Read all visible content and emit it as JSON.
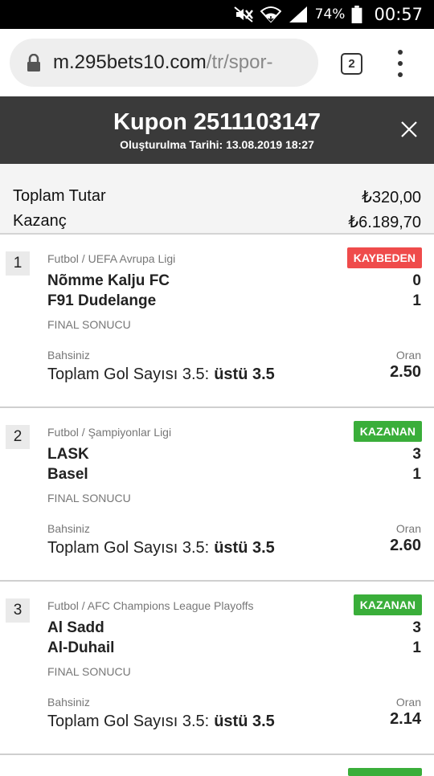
{
  "status_bar": {
    "battery": "74%",
    "time": "00:57"
  },
  "browser": {
    "url_domain": "m.295bets10.com",
    "url_path": "/tr/spor-",
    "tab_count": "2"
  },
  "coupon": {
    "title": "Kupon 2511103147",
    "created": "Oluşturulma Tarihi: 13.08.2019 18:27"
  },
  "summary": {
    "total_label": "Toplam Tutar",
    "total_value": "₺320,00",
    "win_label": "Kazanç",
    "win_value": "₺6.189,70"
  },
  "colors": {
    "lost": "#ef4b4b",
    "won": "#3aae3a",
    "header_bg": "#3a3a3a"
  },
  "bets": [
    {
      "num": "1",
      "league": "Futbol / UEFA Avrupa Ligi",
      "status": "KAYBEDEN",
      "status_color": "#ef4b4b",
      "home": "Nõmme Kalju FC",
      "away": "F91 Dudelange",
      "home_score": "0",
      "away_score": "1",
      "final_label": "FINAL SONUCU",
      "bet_label": "Bahsiniz",
      "odds_label": "Oran",
      "market": "Toplam Gol Sayısı 3.5:",
      "pick": "üstü 3.5",
      "odds": "2.50"
    },
    {
      "num": "2",
      "league": "Futbol / Şampiyonlar Ligi",
      "status": "KAZANAN",
      "status_color": "#3aae3a",
      "home": "LASK",
      "away": "Basel",
      "home_score": "3",
      "away_score": "1",
      "final_label": "FINAL SONUCU",
      "bet_label": "Bahsiniz",
      "odds_label": "Oran",
      "market": "Toplam Gol Sayısı 3.5:",
      "pick": "üstü 3.5",
      "odds": "2.60"
    },
    {
      "num": "3",
      "league": "Futbol / AFC Champions League Playoffs",
      "status": "KAZANAN",
      "status_color": "#3aae3a",
      "home": "Al Sadd",
      "away": "Al-Duhail",
      "home_score": "3",
      "away_score": "1",
      "final_label": "FINAL SONUCU",
      "bet_label": "Bahsiniz",
      "odds_label": "Oran",
      "market": "Toplam Gol Sayısı 3.5:",
      "pick": "üstü 3.5",
      "odds": "2.14"
    }
  ]
}
